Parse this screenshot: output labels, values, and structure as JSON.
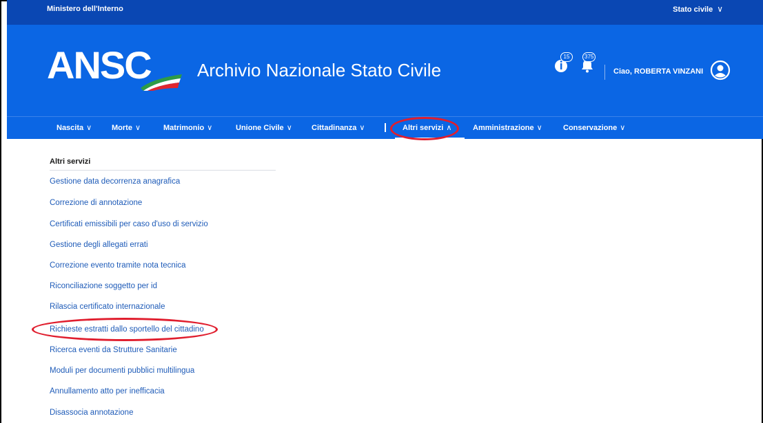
{
  "topbar": {
    "ministry": "Ministero dell'Interno",
    "stato_label": "Stato civile",
    "stato_chevron": "∨"
  },
  "header": {
    "logo_text": "ANSC",
    "app_title": "Archivio Nazionale Stato Civile",
    "notif_count_1": "15",
    "notif_count_2": "375",
    "greeting": "Ciao, ROBERTA VINZANI"
  },
  "nav": {
    "items": [
      {
        "label": "Nascita",
        "chevron": "∨"
      },
      {
        "label": "Morte",
        "chevron": "∨"
      },
      {
        "label": "Matrimonio",
        "chevron": "∨"
      },
      {
        "label": "Unione Civile",
        "chevron": "∨"
      },
      {
        "label": "Cittadinanza",
        "chevron": "∨"
      },
      {
        "label": "Altri servizi",
        "chevron": "∧"
      },
      {
        "label": "Amministrazione",
        "chevron": "∨"
      },
      {
        "label": "Conservazione",
        "chevron": "∨"
      }
    ]
  },
  "menu": {
    "title": "Altri servizi",
    "items": [
      "Gestione data decorrenza anagrafica",
      "Correzione di annotazione",
      "Certificati emissibili per caso d'uso di servizio",
      "Gestione degli allegati errati",
      "Correzione evento tramite nota tecnica",
      "Riconciliazione soggetto per id",
      "Rilascia certificato internazionale",
      "Richieste estratti dallo sportello del cittadino",
      "Ricerca eventi da Strutture Sanitarie",
      "Moduli per documenti pubblici multilingua",
      "Annullamento atto per inefficacia",
      "Disassocia annotazione"
    ]
  },
  "colors": {
    "header_blue": "#0b66e4",
    "topbar_blue": "#0a47b3",
    "link_blue": "#1e5bb8",
    "annotation_red": "#e01e2e"
  }
}
